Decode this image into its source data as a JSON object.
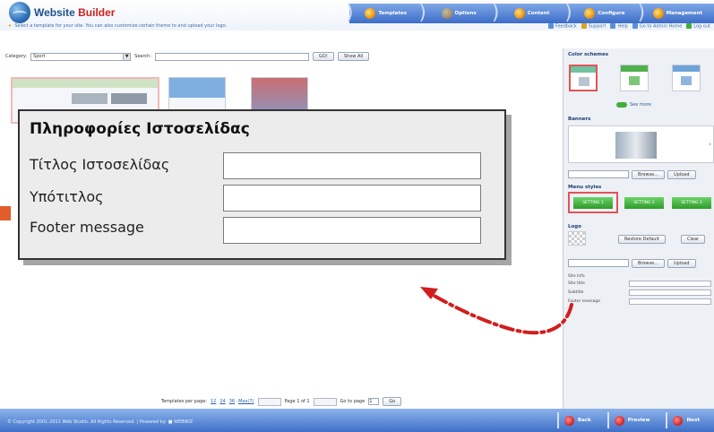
{
  "header": {
    "app_name_part1": "Website",
    "app_name_part2": "Builder",
    "hint": "Select a template for your site. You can also customize certain theme to and upload your logo.",
    "steps": [
      "Templates",
      "Options",
      "Content",
      "Configure",
      "Management"
    ],
    "links": [
      "Feedback",
      "Support",
      "Help",
      "Go to Admin Home",
      "Log out"
    ]
  },
  "filter": {
    "category_label": "Category:",
    "category_value": "Sport",
    "search_label": "Search:",
    "go_label": "GO!",
    "show_all_label": "Show All"
  },
  "pager": {
    "per_page_label": "Templates per page:",
    "per_page_options": [
      "12",
      "24",
      "36",
      "Max(7)"
    ],
    "page_text": "Page 1 of 1",
    "goto_label": "Go to page",
    "goto_value": "1",
    "go_label": "Go"
  },
  "right_panel": {
    "color_schemes_title": "Color schemes",
    "see_more": "See more",
    "banners_title": "Banners",
    "browse_label": "Browse...",
    "upload_label": "Upload",
    "menu_styles_title": "Menu styles",
    "menu_styles": [
      "SETTING 1",
      "SETTING 2",
      "SETTING 3"
    ],
    "logo_title": "Logo",
    "restore_default": "Restore Default",
    "clear_label": "Clear",
    "site_info_title": "Site Info",
    "site_info_rows": [
      "Site title",
      "Subtitle",
      "Footer message"
    ]
  },
  "popup": {
    "title": "Πληροφορίες Ιστοσελίδας",
    "fields": [
      {
        "label": "Τίτλος Ιστοσελίδας",
        "value": ""
      },
      {
        "label": "Υπότιτλος",
        "value": ""
      },
      {
        "label": "Footer message",
        "value": ""
      }
    ]
  },
  "footer": {
    "copyright": "© Copyright 2001-2011 Web Studio. All Rights Reserved. | Powered by: ■ WEBWIZ",
    "back": "Back",
    "preview": "Preview",
    "next": "Next"
  },
  "colors": {
    "header_bar": "#3c6dc9",
    "popup_bg": "#ececec",
    "arrow": "#d21d1d",
    "accent_green": "#3fae3c"
  }
}
